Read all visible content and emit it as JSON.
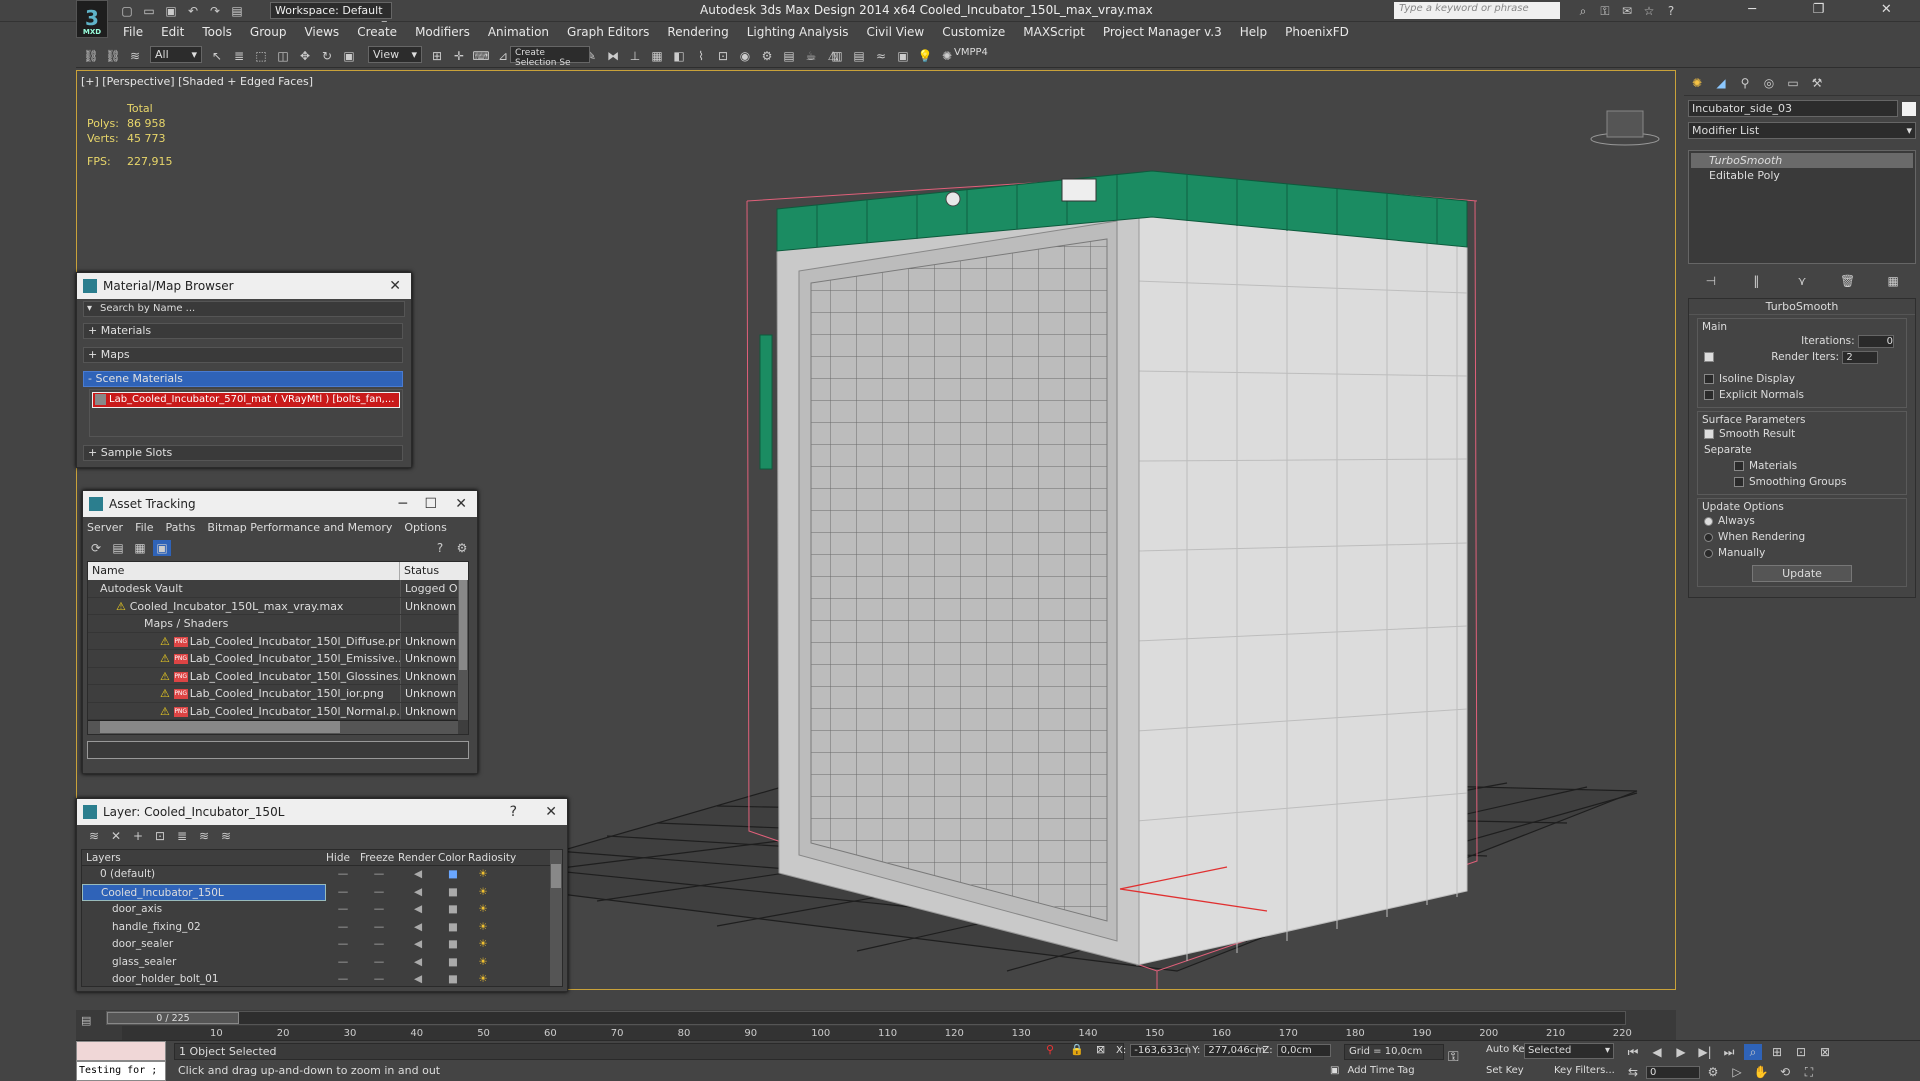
{
  "app": {
    "title": "Autodesk 3ds Max Design 2014 x64     Cooled_Incubator_150L_max_vray.max",
    "logo_text": "MXD",
    "workspace": "Workspace: Default",
    "search_placeholder": "Type a keyword or phrase"
  },
  "menu": [
    "File",
    "Edit",
    "Tools",
    "Group",
    "Views",
    "Create",
    "Modifiers",
    "Animation",
    "Graph Editors",
    "Rendering",
    "Lighting Analysis",
    "Civil View",
    "Customize",
    "MAXScript",
    "Project Manager v.3",
    "Help",
    "PhoenixFD"
  ],
  "toolbar": {
    "filter": "All",
    "refcoord": "View",
    "selection_set": "Create Selection Se",
    "vmpp": "VMPP4"
  },
  "viewport": {
    "label": "[+] [Perspective] [Shaded + Edged Faces]",
    "stats": {
      "total_label": "Total",
      "polys_label": "Polys:",
      "polys": "86 958",
      "verts_label": "Verts:",
      "verts": "45 773",
      "fps_label": "FPS:",
      "fps": "227,915"
    }
  },
  "material_browser": {
    "title": "Material/Map Browser",
    "search_placeholder": "Search by Name ...",
    "sections": {
      "materials": "+ Materials",
      "maps": "+ Maps",
      "scene": "- Scene Materials",
      "sample": "+ Sample Slots"
    },
    "scene_material": "Lab_Cooled_Incubator_570l_mat ( VRayMtl ) [bolts_fan,..."
  },
  "asset_tracking": {
    "title": "Asset Tracking",
    "menu": [
      "Server",
      "File",
      "Paths",
      "Bitmap Performance and Memory",
      "Options"
    ],
    "columns": [
      "Name",
      "Status"
    ],
    "rows": [
      {
        "name": "Autodesk Vault",
        "status": "Logged Out"
      },
      {
        "name": "Cooled_Incubator_150L_max_vray.max",
        "status": "Unknown St"
      },
      {
        "name": "Maps / Shaders",
        "status": ""
      },
      {
        "name": "Lab_Cooled_Incubator_150l_Diffuse.png",
        "status": "Unknown St"
      },
      {
        "name": "Lab_Cooled_Incubator_150l_Emissive....",
        "status": "Unknown St"
      },
      {
        "name": "Lab_Cooled_Incubator_150l_Glossines...",
        "status": "Unknown St"
      },
      {
        "name": "Lab_Cooled_Incubator_150l_ior.png",
        "status": "Unknown St"
      },
      {
        "name": "Lab_Cooled_Incubator_150l_Normal.p...",
        "status": "Unknown St"
      }
    ],
    "png_badge": "PNG"
  },
  "layer_manager": {
    "title": "Layer: Cooled_Incubator_150L",
    "columns": [
      "Layers",
      "Hide",
      "Freeze",
      "Render",
      "Color",
      "Radiosity"
    ],
    "rows": [
      "0 (default)",
      "Cooled_Incubator_150L",
      "door_axis",
      "handle_fixing_02",
      "door_sealer",
      "glass_sealer",
      "door_holder_bolt_01"
    ],
    "help": "?"
  },
  "command_panel": {
    "object_name": "Incubator_side_03",
    "modifier_list": "Modifier List",
    "stack": [
      "TurboSmooth",
      "Editable Poly"
    ],
    "rollout_title": "TurboSmooth",
    "main_label": "Main",
    "iterations_label": "Iterations:",
    "iterations": "0",
    "render_iters_label": "Render Iters:",
    "render_iters": "2",
    "isoline": "Isoline Display",
    "explicit_normals": "Explicit Normals",
    "surface_label": "Surface Parameters",
    "smooth_result": "Smooth Result",
    "separate_label": "Separate",
    "materials": "Materials",
    "smoothing_groups": "Smoothing Groups",
    "update_label": "Update Options",
    "always": "Always",
    "when_rendering": "When Rendering",
    "manually": "Manually",
    "update_button": "Update"
  },
  "timeline": {
    "frame_counter": "0 / 225",
    "ticks": [
      "10",
      "20",
      "30",
      "40",
      "50",
      "60",
      "70",
      "80",
      "90",
      "100",
      "110",
      "120",
      "130",
      "140",
      "150",
      "160",
      "170",
      "180",
      "190",
      "200",
      "210",
      "220"
    ]
  },
  "status": {
    "maxscript": "Testing for ;",
    "selected": "1 Object Selected",
    "prompt": "Click and drag up-and-down to zoom in and out",
    "x_label": "X:",
    "x": "-163,633cn",
    "y_label": "Y:",
    "y": "277,046cm",
    "z_label": "Z:",
    "z": "0,0cm",
    "grid": "Grid = 10,0cm",
    "add_time_tag": "Add Time Tag",
    "auto_key": "Auto Key",
    "set_key": "Set Key",
    "key_mode": "Selected",
    "key_filters": "Key Filters...",
    "frame": "0"
  },
  "colors": {
    "accent_green": "#1b8c62",
    "viewport_border": "#c9a23a",
    "selection_blue": "#2f63b8",
    "highlight_red": "#c91a1a"
  }
}
